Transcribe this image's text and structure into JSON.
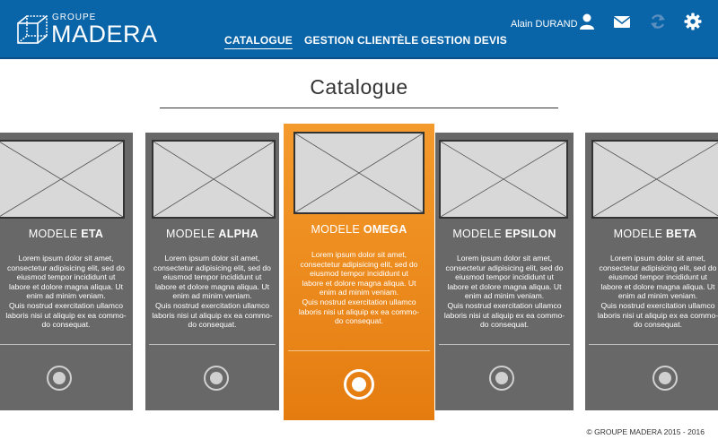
{
  "header": {
    "logo_small": "GROUPE",
    "logo_big": "MADERA",
    "nav": [
      {
        "label": "CATALOGUE"
      },
      {
        "label": "GESTION CLIENTÈLE"
      },
      {
        "label": "GESTION DEVIS"
      }
    ],
    "user_name": "Alain DURAND",
    "icons": [
      "user-icon",
      "envelope-icon",
      "sync-icon",
      "gear-icon"
    ]
  },
  "page": {
    "title": "Catalogue"
  },
  "cards": [
    {
      "prefix": "MODELE",
      "model": "ETA",
      "selected": false
    },
    {
      "prefix": "MODELE",
      "model": "ALPHA",
      "selected": false
    },
    {
      "prefix": "MODELE",
      "model": "OMEGA",
      "selected": true
    },
    {
      "prefix": "MODELE",
      "model": "EPSILON",
      "selected": false
    },
    {
      "prefix": "MODELE",
      "model": "BETA",
      "selected": false
    }
  ],
  "card_text": {
    "line1": "Lorem ipsum dolor sit amet,",
    "line2": "consectetur adipisicing elit, sed do",
    "line3": "eiusmod tempor incididunt ut",
    "line4": "labore et dolore magna aliqua. Ut",
    "line5": "enim ad minim veniam.",
    "line6": "Quis nostrud exercitation ullamco",
    "line7": "laboris nisi ut aliquip ex ea commo-",
    "line8": "do consequat."
  },
  "footer": {
    "text": "© GROUPE MADERA 2015 - 2016"
  },
  "colors": {
    "header": "#0a64a8",
    "card": "#686868",
    "selected": "#f08c1e"
  }
}
